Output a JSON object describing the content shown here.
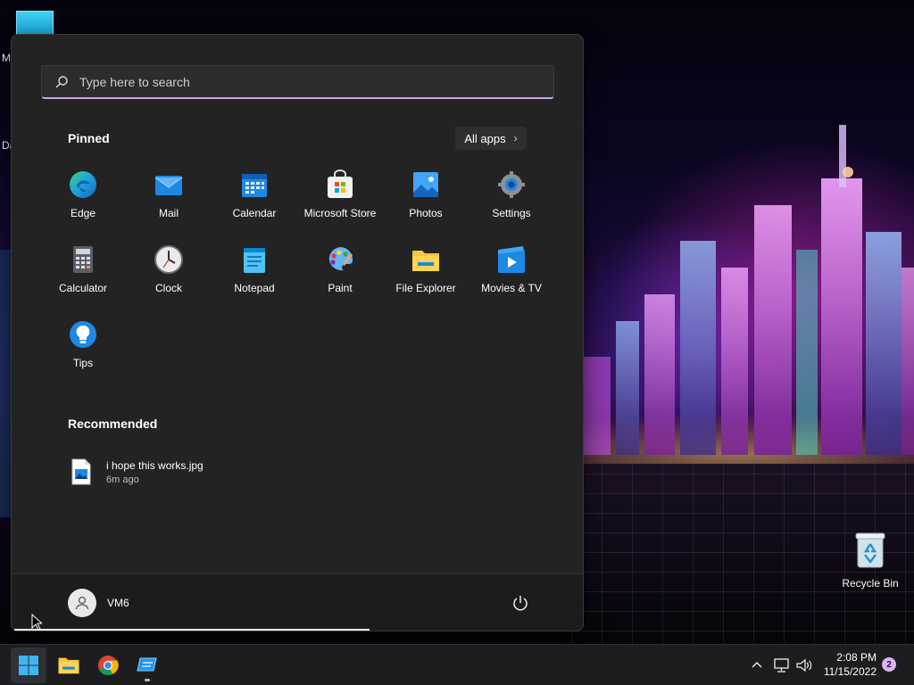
{
  "desktop": {
    "edge_letters": [
      "M",
      "Da"
    ],
    "recycle_bin_label": "Recycle Bin"
  },
  "start_menu": {
    "search": {
      "placeholder": "Type here to search"
    },
    "pinned_title": "Pinned",
    "all_apps_label": "All apps",
    "pinned": [
      {
        "name": "Edge",
        "icon": "edge-icon"
      },
      {
        "name": "Mail",
        "icon": "mail-icon"
      },
      {
        "name": "Calendar",
        "icon": "calendar-icon"
      },
      {
        "name": "Microsoft Store",
        "icon": "store-icon"
      },
      {
        "name": "Photos",
        "icon": "photos-icon"
      },
      {
        "name": "Settings",
        "icon": "settings-icon"
      },
      {
        "name": "Calculator",
        "icon": "calculator-icon"
      },
      {
        "name": "Clock",
        "icon": "clock-icon"
      },
      {
        "name": "Notepad",
        "icon": "notepad-icon"
      },
      {
        "name": "Paint",
        "icon": "paint-icon"
      },
      {
        "name": "File Explorer",
        "icon": "folder-icon"
      },
      {
        "name": "Movies & TV",
        "icon": "movies-icon"
      },
      {
        "name": "Tips",
        "icon": "tips-icon"
      }
    ],
    "recommended_title": "Recommended",
    "recommended": [
      {
        "name": "i hope this works.jpg",
        "time": "6m ago",
        "icon": "image-file-icon"
      }
    ],
    "user": {
      "name": "VM6"
    }
  },
  "taskbar": {
    "time": "2:08 PM",
    "date": "11/15/2022",
    "notification_count": "2"
  },
  "colors": {
    "start_bg": "#232323",
    "search_accent": "#c7a6e8",
    "taskbar_bg": "#1d1d1f",
    "badge": "#d9b3f0"
  }
}
